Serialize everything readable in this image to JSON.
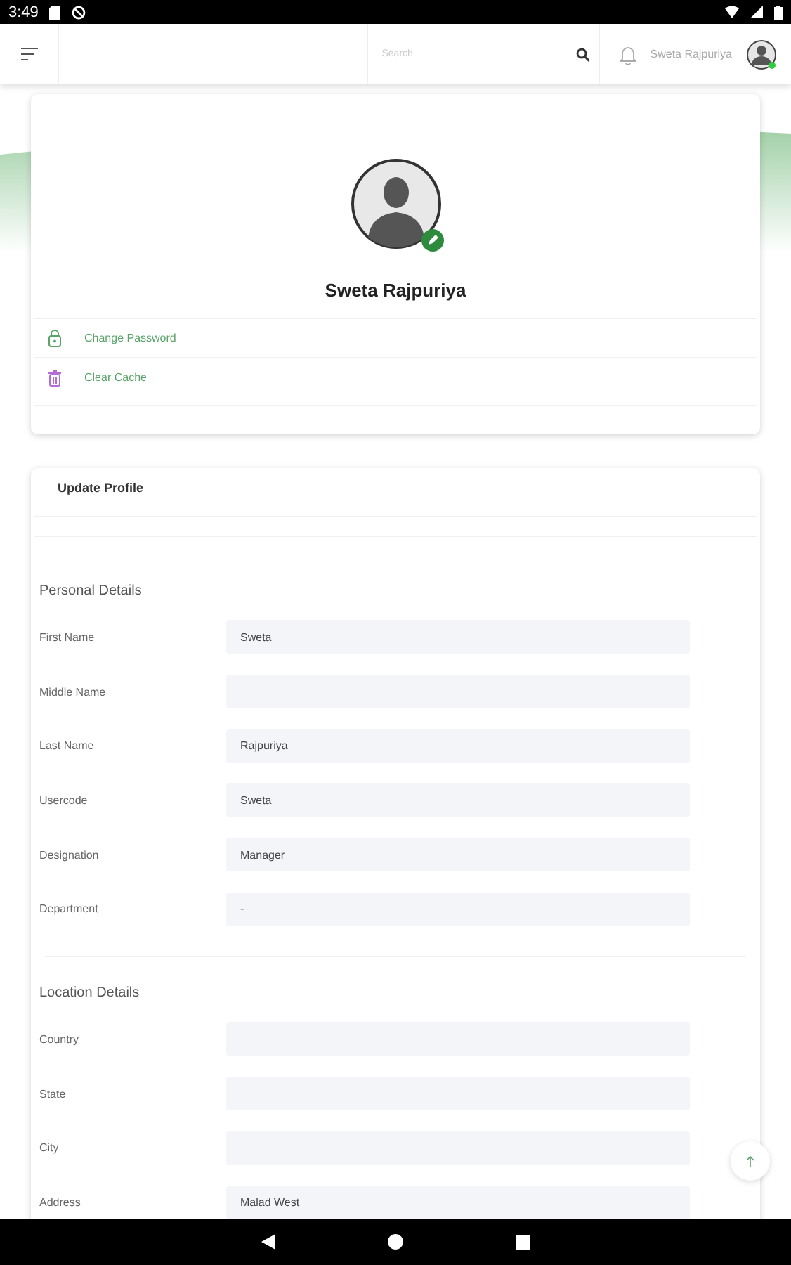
{
  "status_bar": {
    "time": "3:49"
  },
  "header": {
    "search": {
      "placeholder": "Search"
    },
    "user_name": "Sweta Rajpuriya"
  },
  "profile": {
    "name": "Sweta Rajpuriya",
    "actions": [
      {
        "kind": "password",
        "label": "Change Password"
      },
      {
        "kind": "cache",
        "label": "Clear Cache"
      }
    ]
  },
  "update_profile": {
    "title": "Update Profile",
    "sections": [
      {
        "title": "Personal Details",
        "fields": [
          {
            "label": "First Name",
            "value": "Sweta"
          },
          {
            "label": "Middle Name"
          },
          {
            "label": "Last Name",
            "value": "Rajpuriya"
          },
          {
            "label": "Usercode",
            "value": "Sweta"
          },
          {
            "label": "Designation",
            "value": "Manager"
          },
          {
            "label": "Department",
            "value": "-"
          }
        ]
      },
      {
        "title": "Location Details",
        "fields": [
          {
            "label": "Country"
          },
          {
            "label": "State"
          },
          {
            "label": "City"
          },
          {
            "label": "Address",
            "value": "Malad West"
          }
        ]
      }
    ]
  }
}
